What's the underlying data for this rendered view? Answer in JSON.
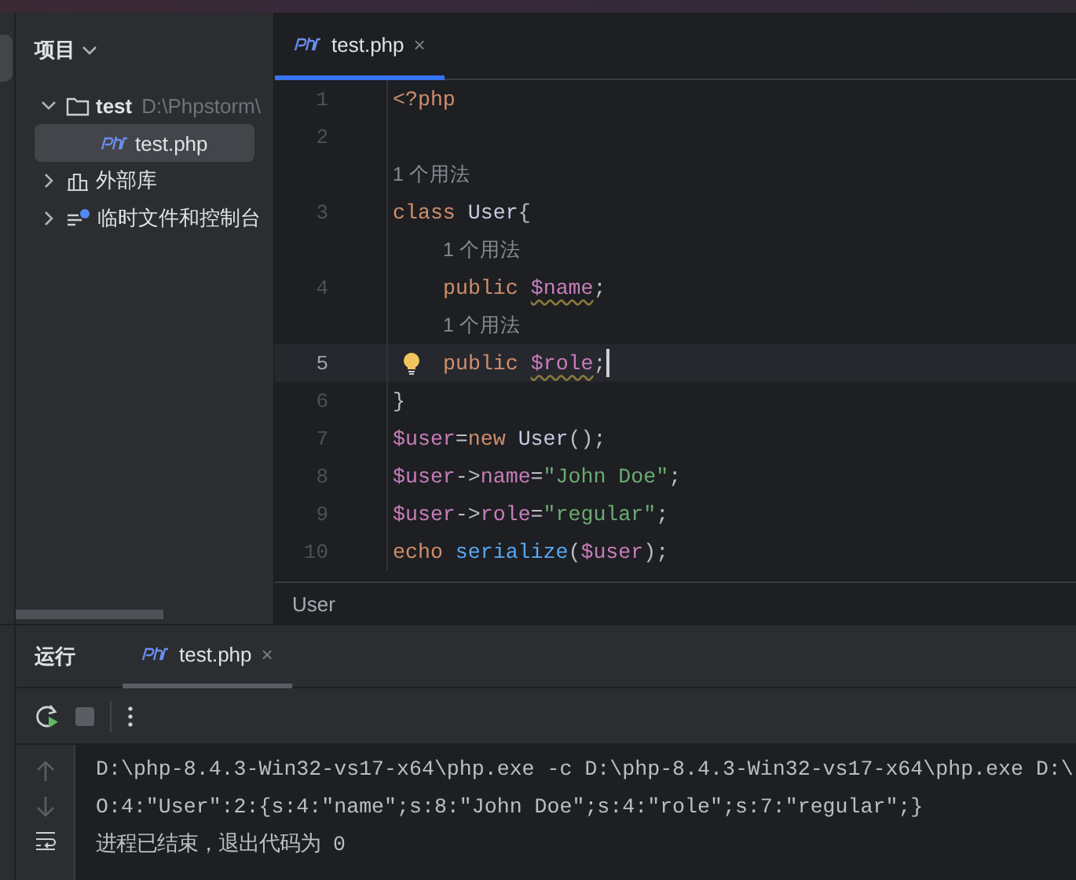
{
  "project_panel": {
    "title": "项目",
    "tree": [
      {
        "label": "test",
        "path": "D:\\Phpstorm\\",
        "kind": "folder",
        "expanded": true,
        "selected": false,
        "children": [
          {
            "label": "test.php",
            "kind": "php",
            "selected": true
          }
        ]
      },
      {
        "label": "外部库",
        "kind": "library",
        "expanded": false,
        "selected": false
      },
      {
        "label": "临时文件和控制台",
        "kind": "scratch",
        "expanded": false,
        "selected": false
      }
    ]
  },
  "editor": {
    "tabs": [
      {
        "label": "test.php",
        "close": "×",
        "selected": true
      }
    ],
    "lines": [
      {
        "kind": "code",
        "number": "1",
        "tokens": [
          {
            "kind": "keyword",
            "text": "<?php"
          }
        ]
      },
      {
        "kind": "code",
        "number": "2"
      },
      {
        "kind": "hint",
        "text": "1 个用法",
        "indented": false
      },
      {
        "kind": "code",
        "number": "3",
        "tokens": [
          {
            "kind": "keyword",
            "text": "class "
          },
          {
            "kind": "class",
            "text": "User"
          },
          {
            "kind": "plain",
            "text": "{"
          }
        ]
      },
      {
        "kind": "hint",
        "text": "1 个用法",
        "indented": true
      },
      {
        "kind": "code",
        "number": "4",
        "indented": true,
        "tokens": [
          {
            "kind": "keyword",
            "text": "public "
          },
          {
            "kind": "var",
            "text": "$name",
            "warning": true
          },
          {
            "kind": "plain",
            "text": ";"
          }
        ]
      },
      {
        "kind": "hint",
        "text": "1 个用法",
        "indented": true
      },
      {
        "kind": "code",
        "number": "5",
        "indented": true,
        "current": true,
        "bulb": true,
        "caret": true,
        "tokens": [
          {
            "kind": "keyword",
            "text": "public "
          },
          {
            "kind": "var",
            "text": "$role",
            "warning": true
          },
          {
            "kind": "plain",
            "text": ";"
          }
        ]
      },
      {
        "kind": "code",
        "number": "6",
        "tokens": [
          {
            "kind": "plain",
            "text": "}"
          }
        ]
      },
      {
        "kind": "code",
        "number": "7",
        "tokens": [
          {
            "kind": "var",
            "text": "$user"
          },
          {
            "kind": "plain",
            "text": "="
          },
          {
            "kind": "keyword",
            "text": "new "
          },
          {
            "kind": "class",
            "text": "User"
          },
          {
            "kind": "plain",
            "text": "();"
          }
        ]
      },
      {
        "kind": "code",
        "number": "8",
        "tokens": [
          {
            "kind": "var",
            "text": "$user"
          },
          {
            "kind": "plain",
            "text": "->"
          },
          {
            "kind": "var",
            "text": "name"
          },
          {
            "kind": "plain",
            "text": "="
          },
          {
            "kind": "string",
            "text": "\"John Doe\""
          },
          {
            "kind": "plain",
            "text": ";"
          }
        ]
      },
      {
        "kind": "code",
        "number": "9",
        "tokens": [
          {
            "kind": "var",
            "text": "$user"
          },
          {
            "kind": "plain",
            "text": "->"
          },
          {
            "kind": "var",
            "text": "role"
          },
          {
            "kind": "plain",
            "text": "="
          },
          {
            "kind": "string",
            "text": "\"regular\""
          },
          {
            "kind": "plain",
            "text": ";"
          }
        ]
      },
      {
        "kind": "code",
        "number": "10",
        "tokens": [
          {
            "kind": "keyword",
            "text": "echo "
          },
          {
            "kind": "func",
            "text": "serialize"
          },
          {
            "kind": "plain",
            "text": "("
          },
          {
            "kind": "var",
            "text": "$user"
          },
          {
            "kind": "plain",
            "text": ");"
          }
        ]
      }
    ],
    "breadcrumb": "User"
  },
  "run_panel": {
    "title": "运行",
    "tabs": [
      {
        "label": "test.php",
        "close": "×",
        "selected": true
      }
    ],
    "output": [
      "D:\\php-8.4.3-Win32-vs17-x64\\php.exe -c D:\\php-8.4.3-Win32-vs17-x64\\php.exe D:\\",
      "O:4:\"User\":2:{s:4:\"name\";s:8:\"John Doe\";s:4:\"role\";s:7:\"regular\";}",
      "进程已结束，退出代码为 0"
    ]
  }
}
